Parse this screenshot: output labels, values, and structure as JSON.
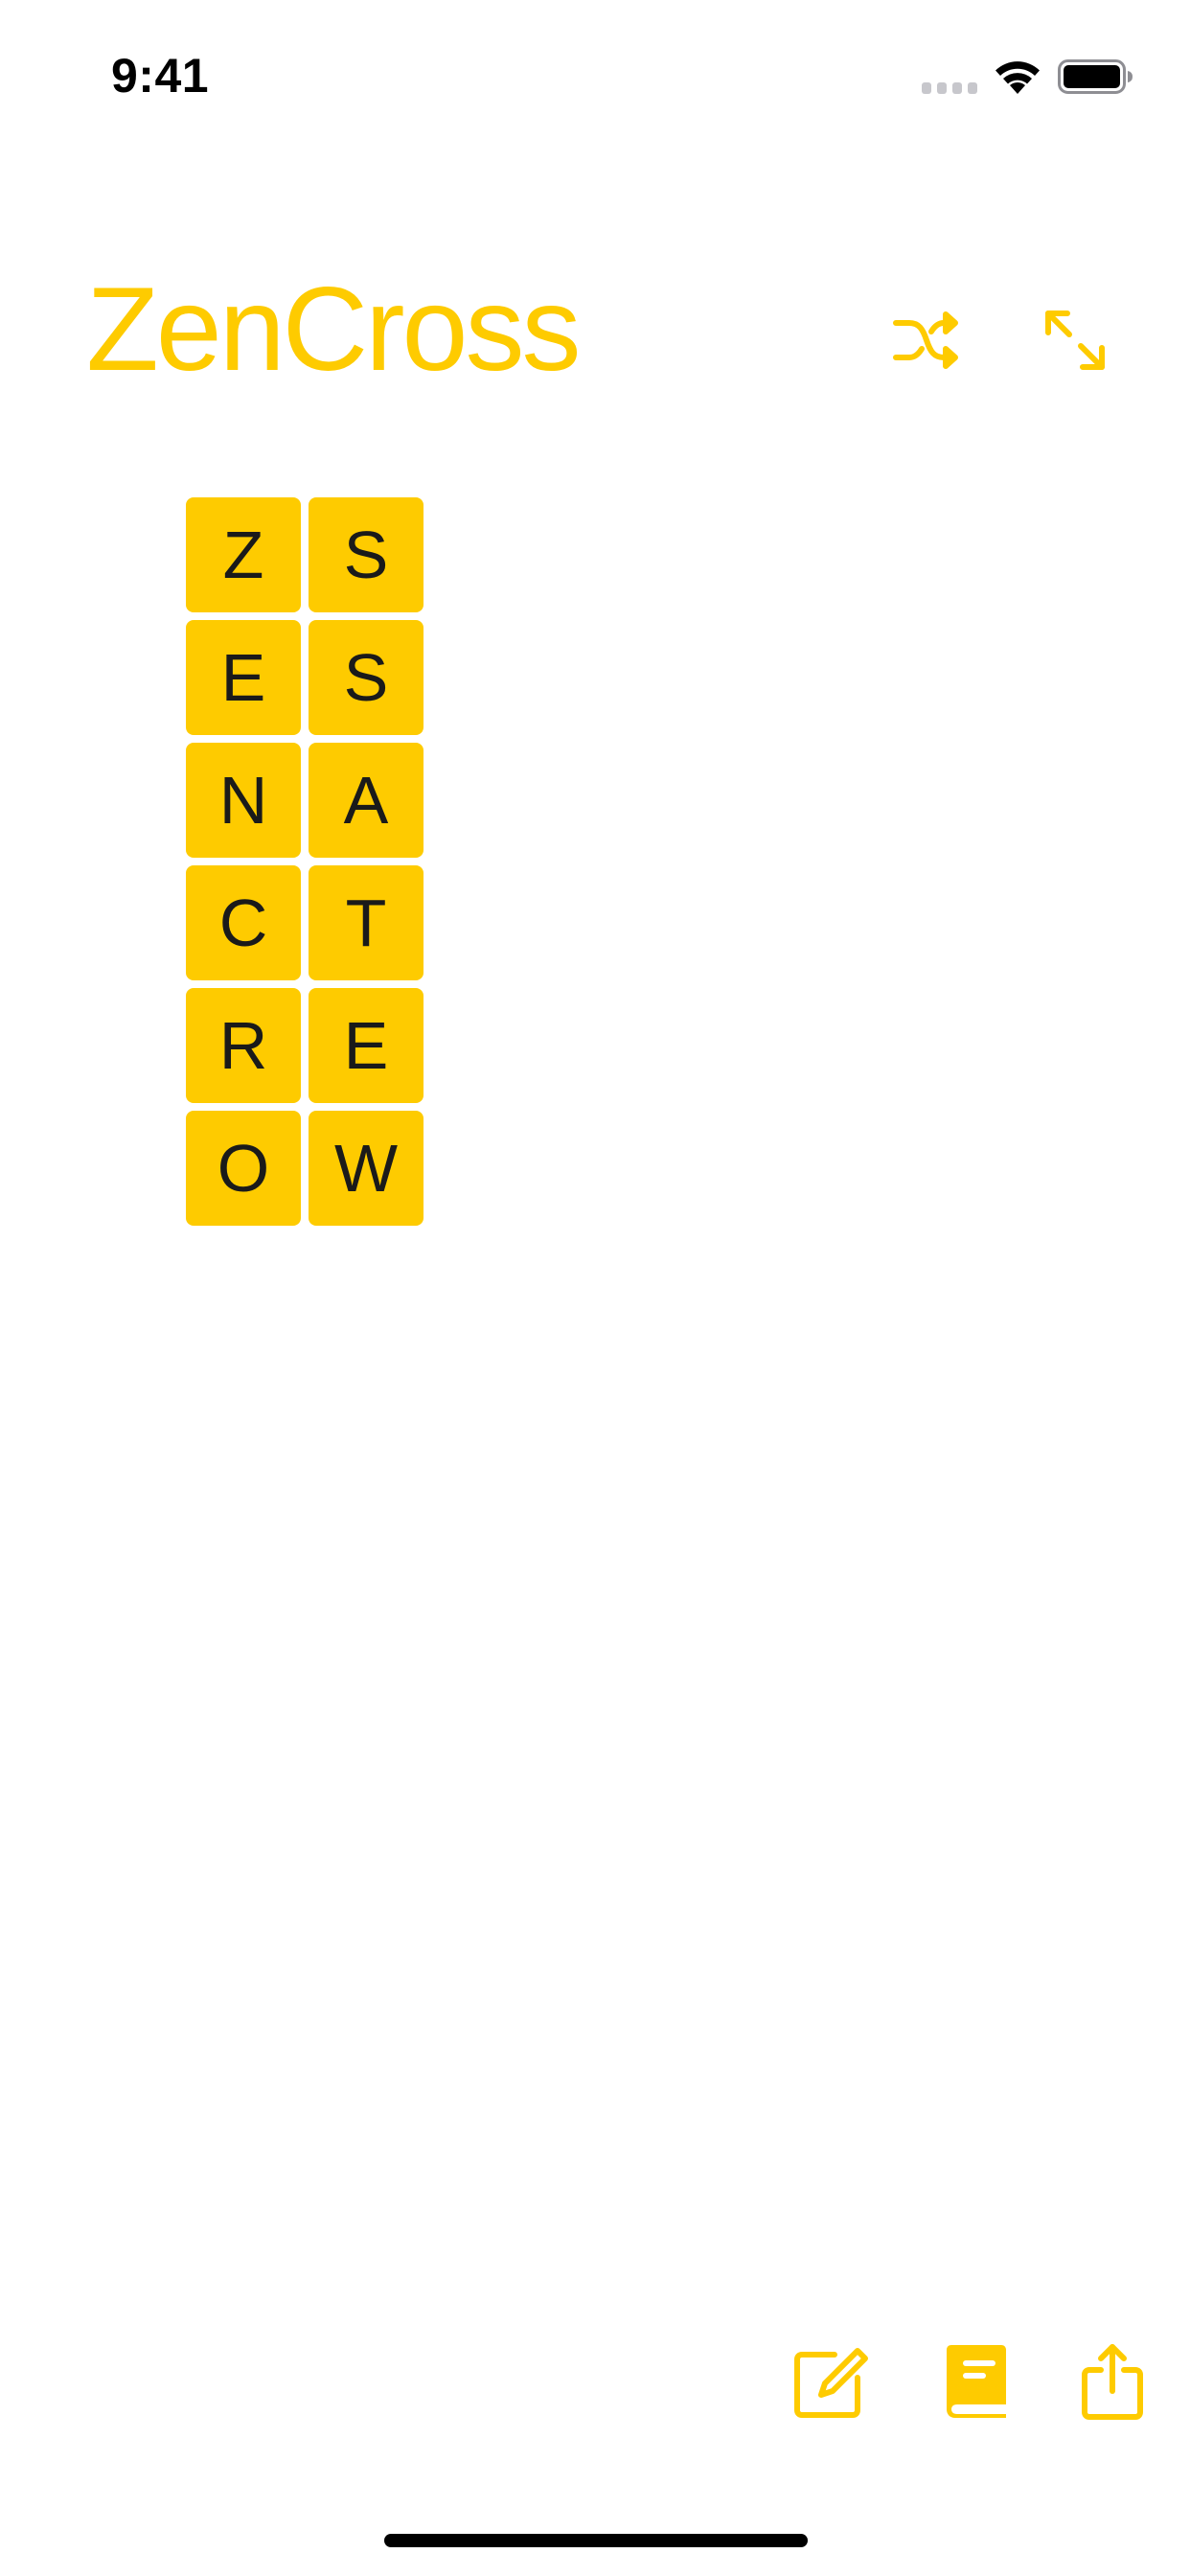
{
  "status_bar": {
    "time": "9:41",
    "icons": [
      "cellular-signal-icon",
      "wifi-icon",
      "battery-icon"
    ]
  },
  "header": {
    "title": "ZenCross",
    "buttons": [
      {
        "icon": "shuffle-icon"
      },
      {
        "icon": "expand-icon"
      }
    ]
  },
  "board": {
    "columns": 2,
    "tiles": [
      "Z",
      "S",
      "E",
      "S",
      "N",
      "A",
      "C",
      "T",
      "R",
      "E",
      "O",
      "W"
    ]
  },
  "toolbar": {
    "buttons": [
      {
        "icon": "compose-icon"
      },
      {
        "icon": "book-icon"
      },
      {
        "icon": "share-icon"
      }
    ]
  },
  "colors": {
    "accent": "#fecb00",
    "tile_text": "#1a1a1a",
    "background": "#ffffff"
  }
}
